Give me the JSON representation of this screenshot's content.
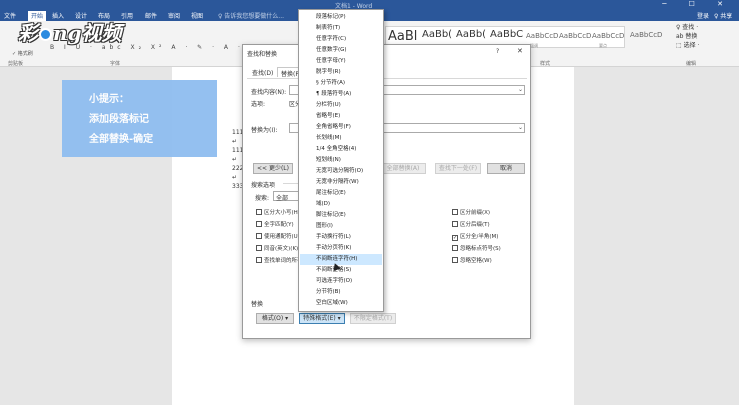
{
  "window": {
    "title": "文档1 - Word",
    "controls": "─ ☐ ✕"
  },
  "menubar": {
    "items": [
      "文件",
      "开始",
      "插入",
      "设计",
      "布局",
      "引用",
      "邮件",
      "审阅",
      "视图"
    ],
    "tell_me": "♀ 告诉我您想要做什么...",
    "login": "登录",
    "share": "♀ 共享"
  },
  "ribbon": {
    "groups": [
      "剪贴板",
      "字体",
      "段落",
      "样式",
      "编辑"
    ],
    "clipboard": {
      "painter": "✓ 格式刷"
    },
    "font_row": "B  I  U ·  abc  X₂  X²   A · ✎ · A · A",
    "styles": [
      "AaBl",
      "AaBb(",
      "AaBb(",
      "AaBbC",
      "AaBbCcD",
      "AaBbCcD",
      "AaBbCcD",
      "AaBbCcD"
    ],
    "style_labels": [
      "",
      "",
      "",
      "",
      "强调",
      "",
      "要点",
      ""
    ],
    "edit": [
      "♀ 查找 ·",
      "ab 替换",
      "⬚ 选择 ·"
    ]
  },
  "logo": {
    "text1": "彩",
    "text2": "ng视频"
  },
  "tip": {
    "line1": "小提示：",
    "line2": "添加段落标记",
    "line3": "全部替换-确定"
  },
  "document": {
    "lines": [
      "111",
      "↵",
      "111",
      "↵",
      "222",
      "↵",
      "333"
    ]
  },
  "dialog": {
    "title": "查找和替换",
    "help": "?",
    "close": "✕",
    "tabs": [
      "查找(D)",
      "替换(P)"
    ],
    "find_label": "查找内容(N):",
    "options_label": "选项:",
    "options_value": "区分",
    "replace_label": "替换为(I):",
    "less_button": "<< 更少(L)",
    "replace_all_button": "全部替换(A)",
    "find_next_button": "查找下一处(F)",
    "cancel_button": "取消",
    "search_options_label": "搜索选项",
    "search_label": "搜索:",
    "search_value": "全部",
    "left_checks": [
      {
        "label": "区分大小写(H)",
        "checked": false
      },
      {
        "label": "全字匹配(Y)",
        "checked": false
      },
      {
        "label": "使用通配符(U)",
        "checked": false
      },
      {
        "label": "同音(英文)(K)",
        "checked": false
      },
      {
        "label": "查找单词的所有",
        "checked": false
      }
    ],
    "right_checks": [
      {
        "label": "区分前缀(X)",
        "checked": false
      },
      {
        "label": "区分后缀(T)",
        "checked": false
      },
      {
        "label": "区分全/半角(M)",
        "checked": true
      },
      {
        "label": "忽略标点符号(S)",
        "checked": false
      },
      {
        "label": "忽略空格(W)",
        "checked": false
      }
    ],
    "replace_section_label": "替换",
    "format_button": "格式(O) ▾",
    "special_button": "特殊格式(E) ▾",
    "no_format_button": "不限定格式(T)"
  },
  "special_menu": {
    "items": [
      "段落标记(P)",
      "制表符(T)",
      "任意字符(C)",
      "任意数字(G)",
      "任意字母(Y)",
      "脱字号(R)",
      "§ 分节符(A)",
      "¶ 段落符号(A)",
      "分栏符(U)",
      "省略号(E)",
      "全角省略号(F)",
      "长划线(M)",
      "1/4 全角空格(4)",
      "短划线(N)",
      "无宽可选分隔符(O)",
      "无宽非分隔符(W)",
      "尾注标记(E)",
      "域(D)",
      "脚注标记(E)",
      "图形(I)",
      "手动换行符(L)",
      "手动分页符(K)",
      "不间断连字符(H)",
      "不间断空格(S)",
      "可选连字符(O)",
      "分节符(B)",
      "空白区域(W)"
    ],
    "highlighted_index": 22
  }
}
